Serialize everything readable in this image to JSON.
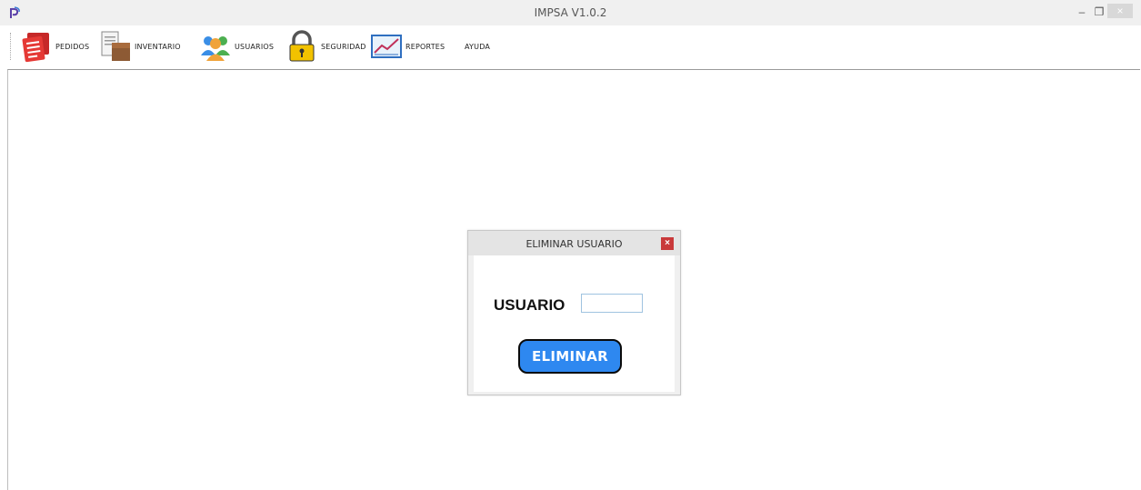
{
  "window": {
    "title": "IMPSA V1.0.2",
    "minimize_glyph": "–",
    "restore_glyph": "❐",
    "close_glyph": "×"
  },
  "toolbar": {
    "items": [
      {
        "label": "PEDIDOS",
        "icon": "orders-icon"
      },
      {
        "label": "INVENTARIO",
        "icon": "inventory-icon"
      },
      {
        "label": "USUARIOS",
        "icon": "users-icon"
      },
      {
        "label": "SEGURIDAD",
        "icon": "lock-icon"
      },
      {
        "label": "REPORTES",
        "icon": "chart-icon"
      },
      {
        "label": "AYUDA",
        "icon": ""
      }
    ]
  },
  "dialog": {
    "title": "ELIMINAR USUARIO",
    "close_glyph": "×",
    "user_label": "USUARIO",
    "user_value": "",
    "delete_label": "ELIMINAR"
  },
  "colors": {
    "accent_button": "#2e88f0",
    "dialog_close": "#c9393a",
    "input_border": "#9fc3e0"
  }
}
